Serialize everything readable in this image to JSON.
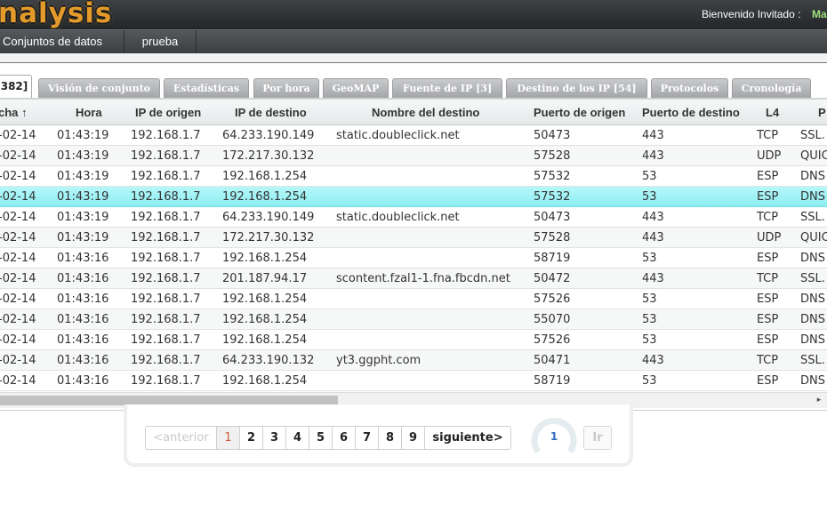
{
  "header": {
    "logo": "nalysis",
    "welcome": "Bienvenido Invitado :",
    "user": "Ma"
  },
  "nav": [
    {
      "label": "Conjuntos de datos"
    },
    {
      "label": "prueba"
    }
  ],
  "tabs": [
    {
      "label": "382]",
      "active": true
    },
    {
      "label": "Visión de conjunto"
    },
    {
      "label": "Estadísticas"
    },
    {
      "label": "Por hora"
    },
    {
      "label": "GeoMAP"
    },
    {
      "label": "Fuente de IP [3]"
    },
    {
      "label": "Destino de los IP [54]"
    },
    {
      "label": "Protocolos"
    },
    {
      "label": "Cronología"
    }
  ],
  "table": {
    "columns": [
      "cha ↑",
      "Hora",
      "IP de origen",
      "IP de destino",
      "Nombre del destino",
      "Puerto de origen",
      "Puerto de destino",
      "L4",
      "P"
    ],
    "selected_row": 3,
    "rows": [
      [
        "-02-14",
        "01:43:19",
        "192.168.1.7",
        "64.233.190.149",
        "static.doubleclick.net",
        "50473",
        "443",
        "TCP",
        "SSL."
      ],
      [
        "-02-14",
        "01:43:19",
        "192.168.1.7",
        "172.217.30.132",
        "",
        "57528",
        "443",
        "UDP",
        "QUIC"
      ],
      [
        "-02-14",
        "01:43:19",
        "192.168.1.7",
        "192.168.1.254",
        "",
        "57532",
        "53",
        "ESP",
        "DNS"
      ],
      [
        "-02-14",
        "01:43:19",
        "192.168.1.7",
        "192.168.1.254",
        "",
        "57532",
        "53",
        "ESP",
        "DNS"
      ],
      [
        "-02-14",
        "01:43:19",
        "192.168.1.7",
        "64.233.190.149",
        "static.doubleclick.net",
        "50473",
        "443",
        "TCP",
        "SSL."
      ],
      [
        "-02-14",
        "01:43:19",
        "192.168.1.7",
        "172.217.30.132",
        "",
        "57528",
        "443",
        "UDP",
        "QUIC"
      ],
      [
        "-02-14",
        "01:43:16",
        "192.168.1.7",
        "192.168.1.254",
        "",
        "58719",
        "53",
        "ESP",
        "DNS"
      ],
      [
        "-02-14",
        "01:43:16",
        "192.168.1.7",
        "201.187.94.17",
        "scontent.fzal1-1.fna.fbcdn.net",
        "50472",
        "443",
        "TCP",
        "SSL."
      ],
      [
        "-02-14",
        "01:43:16",
        "192.168.1.7",
        "192.168.1.254",
        "",
        "57526",
        "53",
        "ESP",
        "DNS"
      ],
      [
        "-02-14",
        "01:43:16",
        "192.168.1.7",
        "192.168.1.254",
        "",
        "55070",
        "53",
        "ESP",
        "DNS"
      ],
      [
        "-02-14",
        "01:43:16",
        "192.168.1.7",
        "192.168.1.254",
        "",
        "57526",
        "53",
        "ESP",
        "DNS"
      ],
      [
        "-02-14",
        "01:43:16",
        "192.168.1.7",
        "64.233.190.132",
        "yt3.ggpht.com",
        "50471",
        "443",
        "TCP",
        "SSL."
      ],
      [
        "-02-14",
        "01:43:16",
        "192.168.1.7",
        "192.168.1.254",
        "",
        "58719",
        "53",
        "ESP",
        "DNS"
      ]
    ]
  },
  "scrollbar": {
    "arrow_icon": "▸"
  },
  "pagination": {
    "prev_label": "<anterior",
    "pages": [
      "1",
      "2",
      "3",
      "4",
      "5",
      "6",
      "7",
      "8",
      "9"
    ],
    "current_page": "1",
    "next_label": "siguiente>",
    "gauge_value": "1",
    "go_label": "Ir"
  },
  "colors": {
    "selected_row": "#8ceef2",
    "logo": "#e39a2a",
    "current_page": "#d05a3a"
  }
}
